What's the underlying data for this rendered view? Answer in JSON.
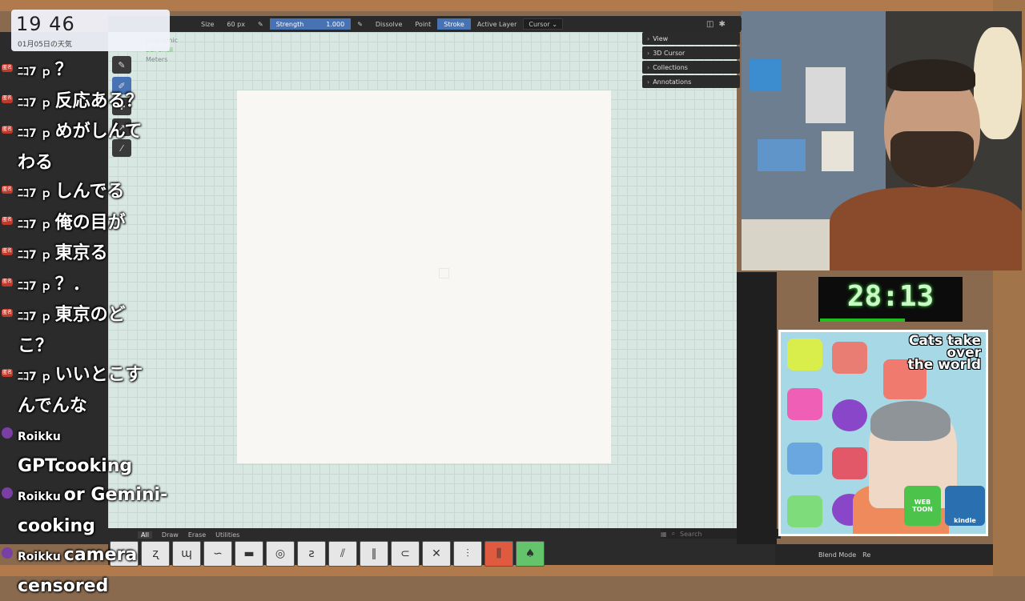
{
  "clock": {
    "time": "19 46",
    "weather": "01月05日の天気"
  },
  "toolbar": {
    "size_label": "Size",
    "size_value": "60 px",
    "strength_label": "Strength",
    "strength_value": "1.000",
    "dissolve": "Dissolve",
    "point": "Point",
    "stroke": "Stroke",
    "active_layer": "Active Layer",
    "cursor": "Cursor"
  },
  "viewport": {
    "ortho_label": "nographic",
    "object_label": "LGPencil",
    "units": "Meters"
  },
  "npanel": {
    "items": [
      {
        "label": "View"
      },
      {
        "label": "3D Cursor"
      },
      {
        "label": "Collections"
      },
      {
        "label": "Annotations"
      }
    ]
  },
  "chat": {
    "badge": "匿名",
    "messages": [
      {
        "name": "ﾆｺ7 ｐ",
        "text": "？"
      },
      {
        "name": "ﾆｺ7 ｐ",
        "text": "反応ある？"
      },
      {
        "name": "ﾆｺ7 ｐ",
        "text": "めがしんて"
      },
      {
        "name": "",
        "text": "わる"
      },
      {
        "name": "ﾆｺ7 ｐ",
        "text": "しんでる"
      },
      {
        "name": "ﾆｺ7 ｐ",
        "text": "俺の目が"
      },
      {
        "name": "ﾆｺ7 ｐ",
        "text": "東京る"
      },
      {
        "name": "ﾆｺ7 ｐ",
        "text": "？．"
      },
      {
        "name": "ﾆｺ7 ｐ",
        "text": "東京のど"
      },
      {
        "name": "",
        "text": "こ？"
      },
      {
        "name": "ﾆｺ7 ｐ",
        "text": "いいとこす"
      },
      {
        "name": "",
        "text": "んでんな"
      },
      {
        "name": "Roikku",
        "text": ""
      },
      {
        "name": "",
        "text": "GPTcooking"
      },
      {
        "name": "Roikku",
        "text": "or Gemini-"
      },
      {
        "name": "",
        "text": "cooking"
      },
      {
        "name": "Roikku",
        "text": "camera"
      },
      {
        "name": "",
        "text": "censored"
      }
    ]
  },
  "brush_tabs": [
    "All",
    "Draw",
    "Erase",
    "Utilities"
  ],
  "search": {
    "placeholder": "Search"
  },
  "bottom_right": {
    "blend_mode": "Blend Mode",
    "re": "Re"
  },
  "timer": {
    "value": "28:13",
    "progress": 0.6
  },
  "webtoon_ad": {
    "title_line1": "Cats take",
    "title_line2": "over",
    "title_line3": "the world",
    "logo_webtoon": "WEB TOON",
    "logo_kindle": "kindle"
  }
}
